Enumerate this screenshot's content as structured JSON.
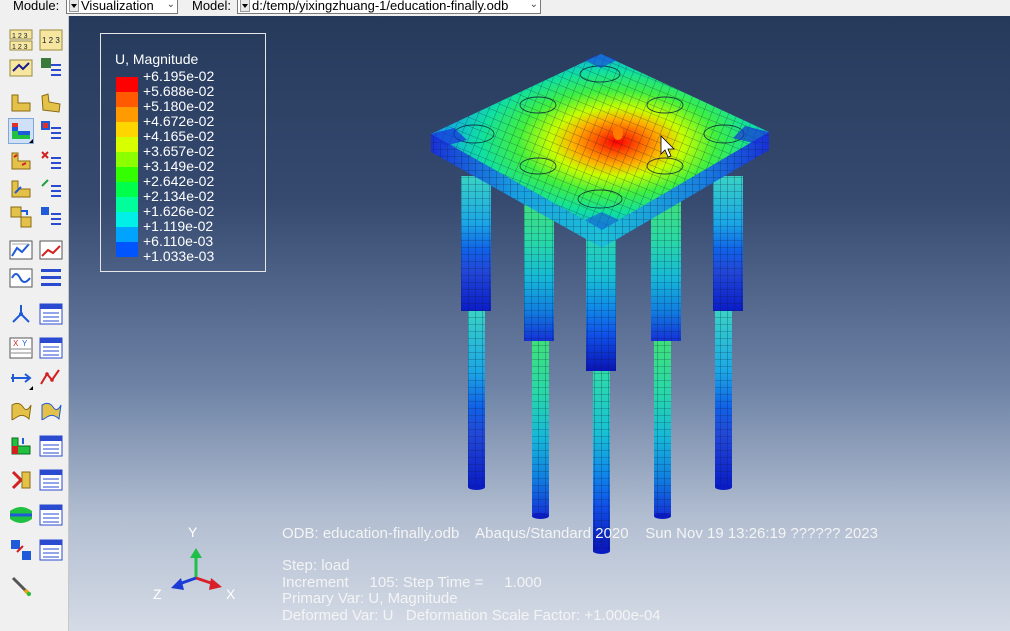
{
  "context_bar": {
    "module_label": "Module:",
    "module_value": "Visualization",
    "model_label": "Model:",
    "model_value": "d:/temp/yixingzhuang-1/education-finally.odb"
  },
  "legend": {
    "title": "U, Magnitude",
    "values": [
      "+6.195e-02",
      "+5.688e-02",
      "+5.180e-02",
      "+4.672e-02",
      "+4.165e-02",
      "+3.657e-02",
      "+3.149e-02",
      "+2.642e-02",
      "+2.134e-02",
      "+1.626e-02",
      "+1.119e-02",
      "+6.110e-03",
      "+1.033e-03"
    ],
    "colors": [
      "#ff0000",
      "#ff5a00",
      "#ff9a00",
      "#ffd500",
      "#d8ff00",
      "#8cff00",
      "#33ff00",
      "#00ff4a",
      "#00ff9c",
      "#00f0e8",
      "#00a4ff",
      "#0055ff",
      "#0000ff"
    ]
  },
  "info": {
    "header": "ODB: education-finally.odb    Abaqus/Standard 2020    Sun Nov 19 13:26:19 ?????? 2023",
    "step": "Step: load",
    "increment": "Increment     105: Step Time =     1.000",
    "primary": "Primary Var: U, Magnitude",
    "deformed": "Deformed Var: U   Deformation Scale Factor: +1.000e-04"
  },
  "triad": {
    "y": "Y",
    "z": "Z",
    "x": "X",
    "colors": {
      "y": "#1fc04a",
      "x": "#d8202a",
      "z": "#1c3ad6"
    }
  }
}
